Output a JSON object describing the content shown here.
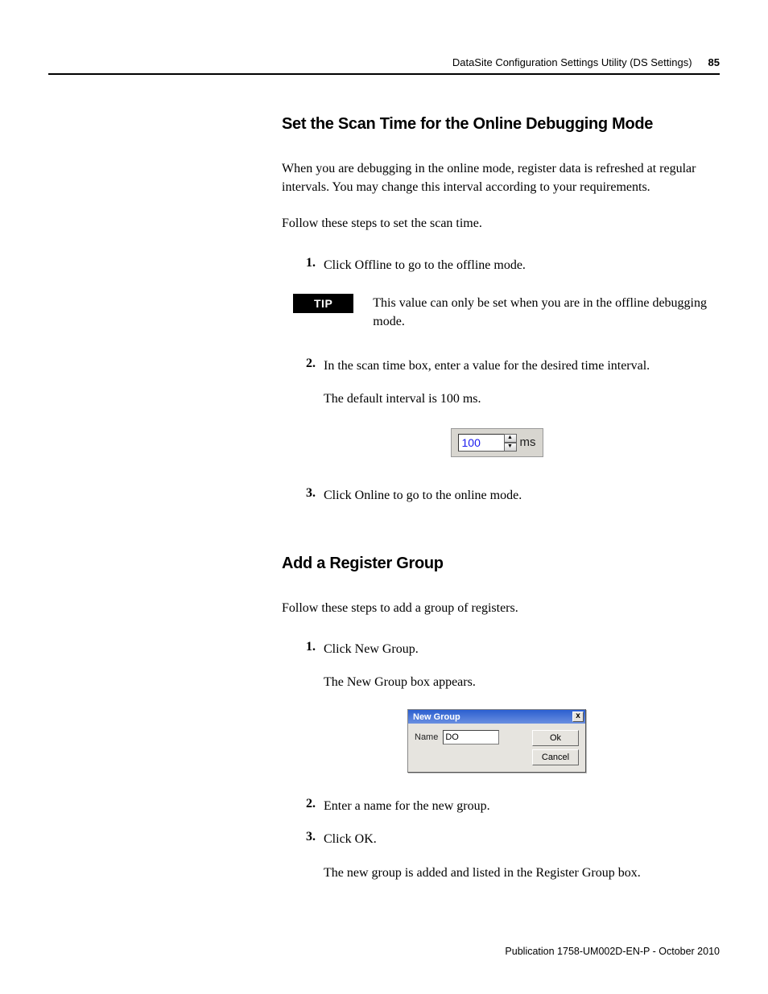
{
  "header": {
    "title": "DataSite Configuration Settings Utility (DS Settings)",
    "pageNumber": "85"
  },
  "section1": {
    "heading": "Set the Scan Time for the Online Debugging Mode",
    "intro": "When you are debugging in the online mode, register data is refreshed at regular intervals. You may change this interval according to your requirements.",
    "lead": "Follow these steps to set the scan time.",
    "steps": {
      "s1": {
        "num": "1.",
        "text": "Click Offline to go to the offline mode."
      },
      "s2": {
        "num": "2.",
        "text": "In the scan time box, enter a value for the desired time interval.",
        "sub": "The default interval is 100 ms."
      },
      "s3": {
        "num": "3.",
        "text": "Click Online to go to the online mode."
      }
    },
    "tip": {
      "label": "TIP",
      "text": "This value can only be set when you are in the offline debugging mode."
    },
    "scanBox": {
      "value": "100",
      "unit": "ms"
    }
  },
  "section2": {
    "heading": "Add a Register Group",
    "lead": "Follow these steps to add a group of registers.",
    "steps": {
      "s1": {
        "num": "1.",
        "text": "Click New Group.",
        "sub": "The New Group box appears."
      },
      "s2": {
        "num": "2.",
        "text": "Enter a name for the new group."
      },
      "s3": {
        "num": "3.",
        "text": "Click OK.",
        "sub": "The new group is added and listed in the Register Group box."
      }
    },
    "dialog": {
      "title": "New Group",
      "close": "x",
      "nameLabel": "Name",
      "nameValue": "DO",
      "okLabel": "Ok",
      "cancelLabel": "Cancel"
    }
  },
  "footer": "Publication 1758-UM002D-EN-P - October 2010"
}
